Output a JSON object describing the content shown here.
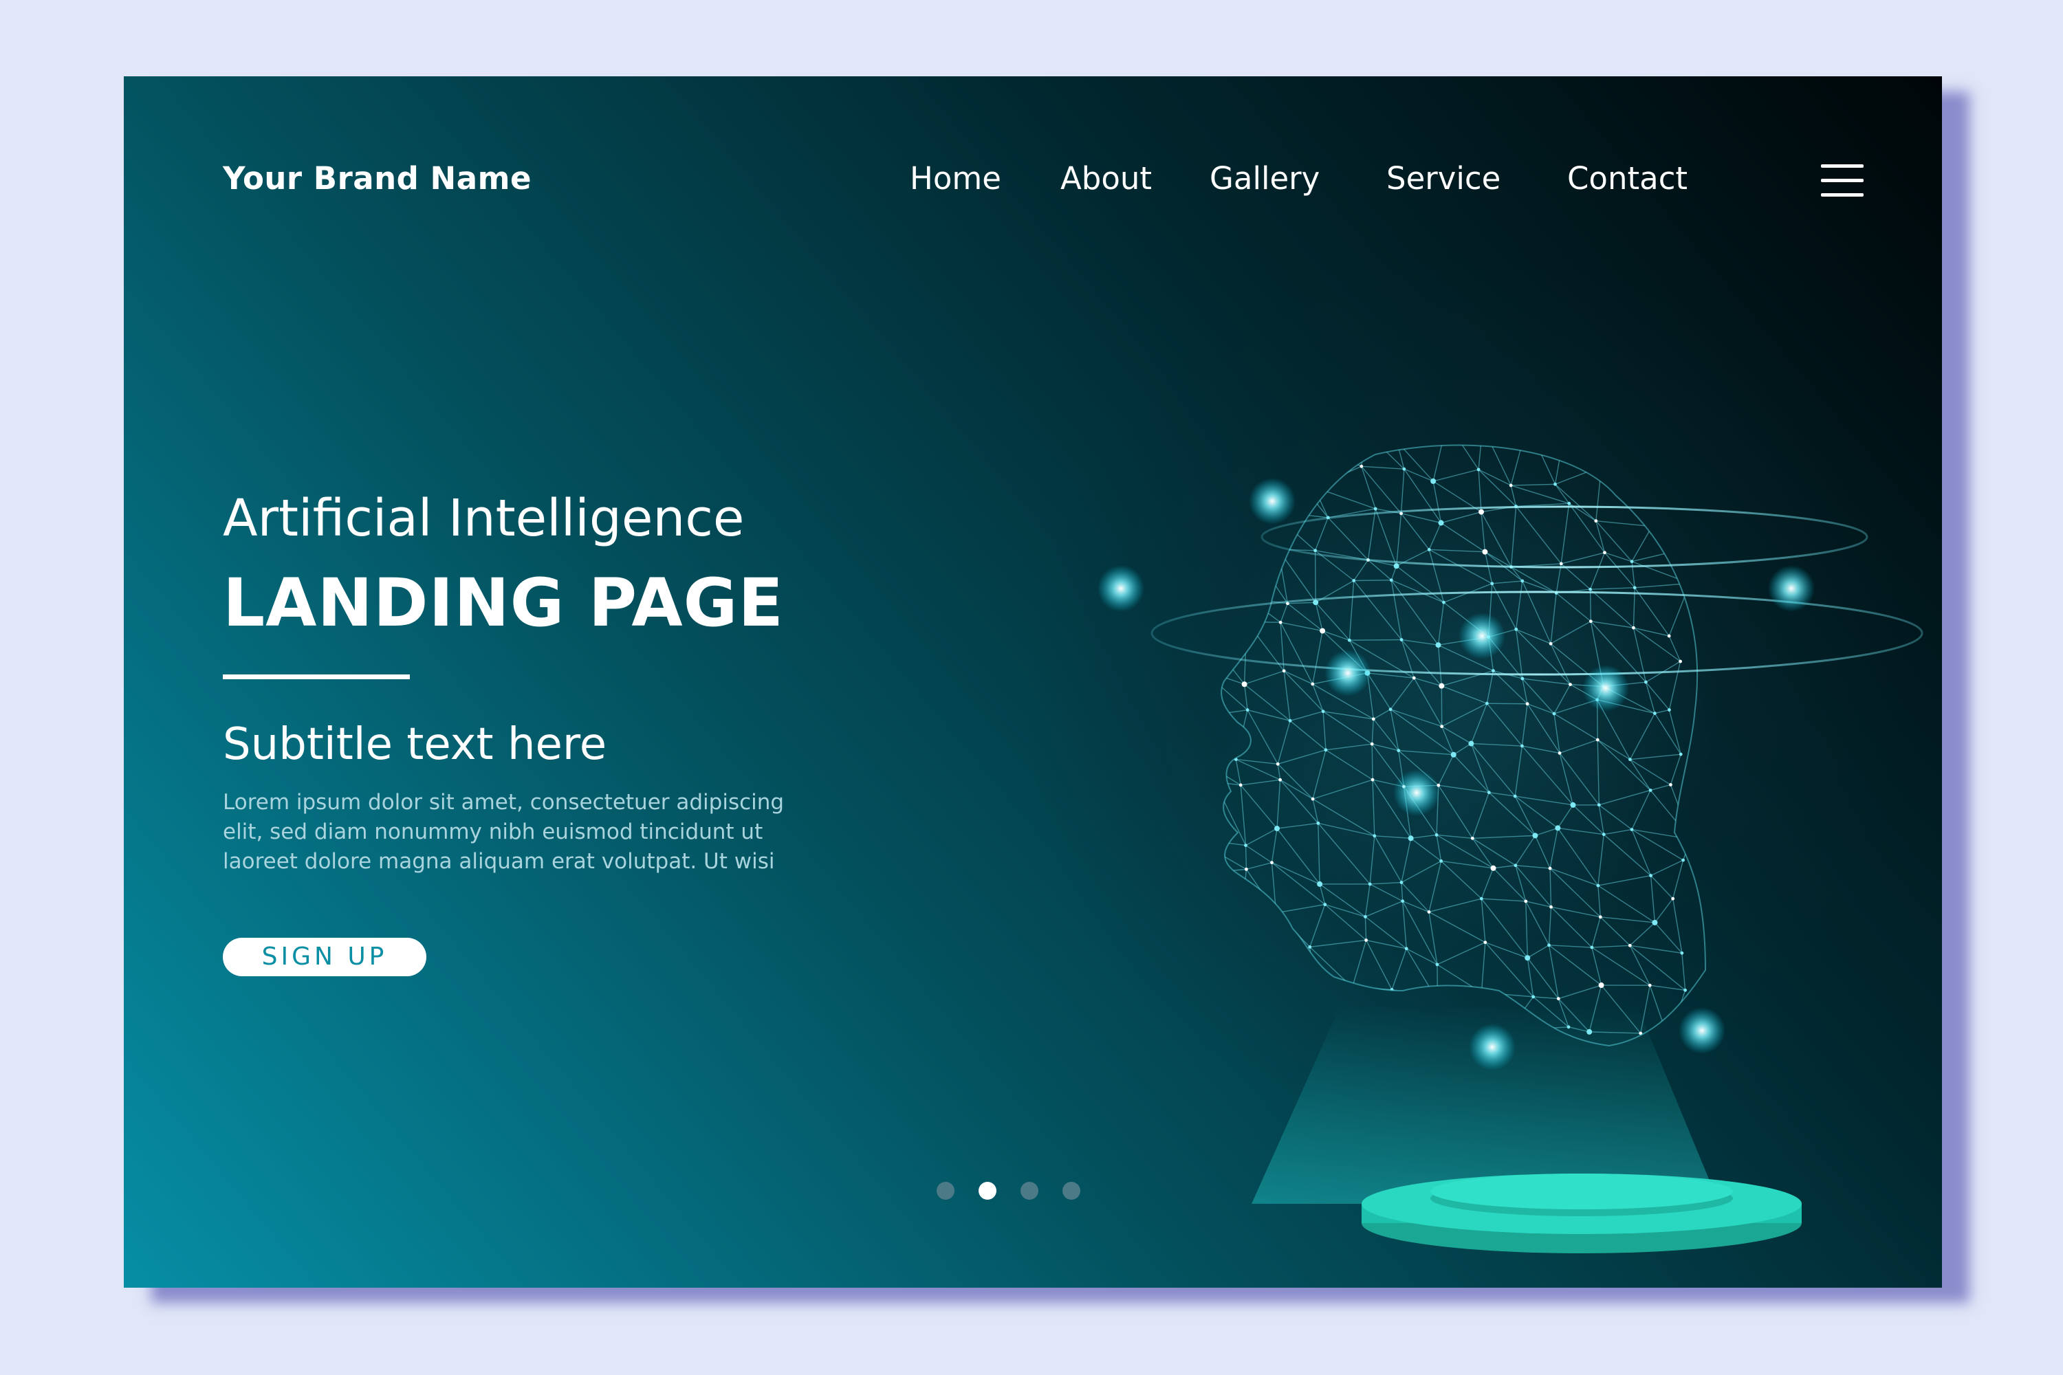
{
  "header": {
    "brand": "Your Brand Name",
    "nav": [
      "Home",
      "About",
      "Gallery",
      "Service",
      "Contact"
    ],
    "menu_icon": "hamburger-menu-icon"
  },
  "hero": {
    "title_line1": "Artificial Intelligence",
    "title_line2": "LANDING PAGE",
    "subtitle": "Subtitle text here",
    "body": "Lorem ipsum dolor sit amet, consectetuer adipiscing elit, sed diam nonummy nibh euismod tincidunt ut laoreet dolore magna aliquam erat volutpat. Ut wisi",
    "cta_label": "SIGN UP"
  },
  "carousel": {
    "total": 4,
    "active_index": 1
  },
  "illustration": {
    "description_icon": "polygon-head-hologram-icon"
  },
  "colors": {
    "page_background": "#e1e6f8",
    "gradient_dark": "#000608",
    "gradient_light": "#068ea5",
    "accent": "#2ad8c2",
    "cta_text": "#0a8ea4",
    "text": "#ffffff",
    "body_text": "#a9d4de"
  }
}
